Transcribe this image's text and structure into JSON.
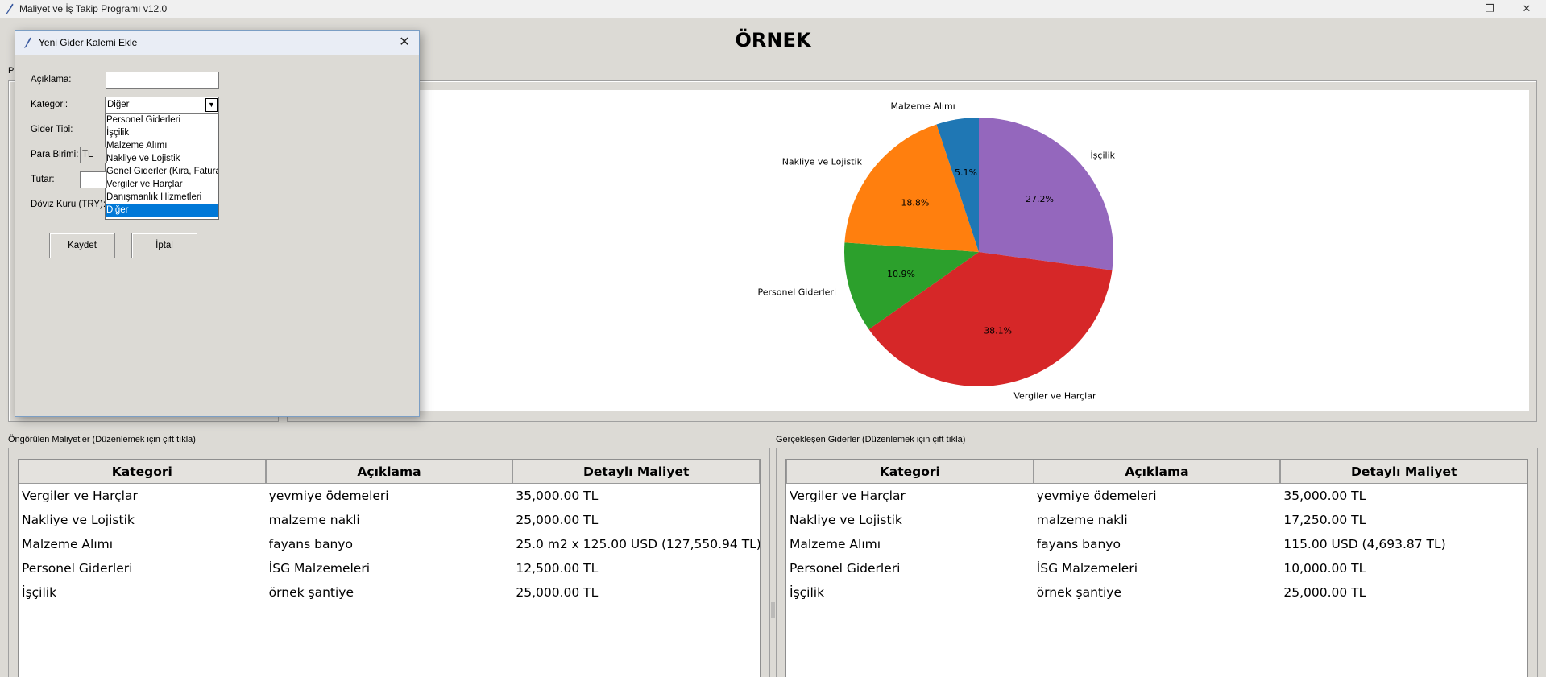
{
  "window": {
    "title": "Maliyet ve İş Takip Programı v12.0",
    "minimize_icon": "minimize-icon",
    "maximize_icon": "restore-icon",
    "close_icon": "close-icon"
  },
  "heading": "ÖRNEK",
  "left_panel_label": "Pr",
  "chart_data": {
    "type": "pie",
    "title": "",
    "slices": [
      {
        "label": "İşçilik",
        "percent": 27.2,
        "color": "#9467bd"
      },
      {
        "label": "Vergiler ve Harçlar",
        "percent": 38.1,
        "color": "#d62728"
      },
      {
        "label": "Personel Giderleri",
        "percent": 10.9,
        "color": "#2ca02c"
      },
      {
        "label": "Nakliye ve Lojistik",
        "percent": 18.8,
        "color": "#ff7f0e"
      },
      {
        "label": "Malzeme Alımı",
        "percent": 5.1,
        "color": "#1f77b4"
      }
    ],
    "start_angle_deg": 90,
    "direction": "clockwise",
    "legend": "none"
  },
  "forecast_table": {
    "caption": "Öngörülen Maliyetler (Düzenlemek için çift tıkla)",
    "headers": [
      "Kategori",
      "Açıklama",
      "Detaylı Maliyet"
    ],
    "rows": [
      [
        "Vergiler ve Harçlar",
        "yevmiye ödemeleri",
        "35,000.00 TL"
      ],
      [
        "Nakliye ve Lojistik",
        "malzeme nakli",
        "25,000.00 TL"
      ],
      [
        "Malzeme Alımı",
        "fayans banyo",
        "25.0 m2 x 125.00 USD (127,550.94 TL)"
      ],
      [
        "Personel Giderleri",
        "İSG Malzemeleri",
        "12,500.00 TL"
      ],
      [
        "İşçilik",
        "örnek şantiye",
        "25,000.00 TL"
      ]
    ]
  },
  "actual_table": {
    "caption": "Gerçekleşen Giderler (Düzenlemek için çift tıkla)",
    "headers": [
      "Kategori",
      "Açıklama",
      "Detaylı Maliyet"
    ],
    "rows": [
      [
        "Vergiler ve Harçlar",
        "yevmiye ödemeleri",
        "35,000.00 TL"
      ],
      [
        "Nakliye ve Lojistik",
        "malzeme nakli",
        "17,250.00 TL"
      ],
      [
        "Malzeme Alımı",
        "fayans banyo",
        "115.00 USD (4,693.87 TL)"
      ],
      [
        "Personel Giderleri",
        "İSG Malzemeleri",
        "10,000.00 TL"
      ],
      [
        "İşçilik",
        "örnek şantiye",
        "25,000.00 TL"
      ]
    ]
  },
  "dialog": {
    "title": "Yeni Gider Kalemi Ekle",
    "labels": {
      "description": "Açıklama:",
      "category": "Kategori:",
      "expense_type": "Gider Tipi:",
      "currency": "Para Birimi:",
      "amount": "Tutar:",
      "exchange_rate": "Döviz Kuru (TRY):"
    },
    "description_value": "",
    "category_value": "Diğer",
    "currency_value": "TL",
    "amount_value": "",
    "category_options": [
      "Personel Giderleri",
      "İşçilik",
      "Malzeme Alımı",
      "Nakliye ve Lojistik",
      "Genel Giderler (Kira, Fatura",
      "Vergiler ve Harçlar",
      "Danışmanlık Hizmetleri",
      "Diğer"
    ],
    "selected_option_index": 7,
    "save_label": "Kaydet",
    "cancel_label": "İptal"
  }
}
